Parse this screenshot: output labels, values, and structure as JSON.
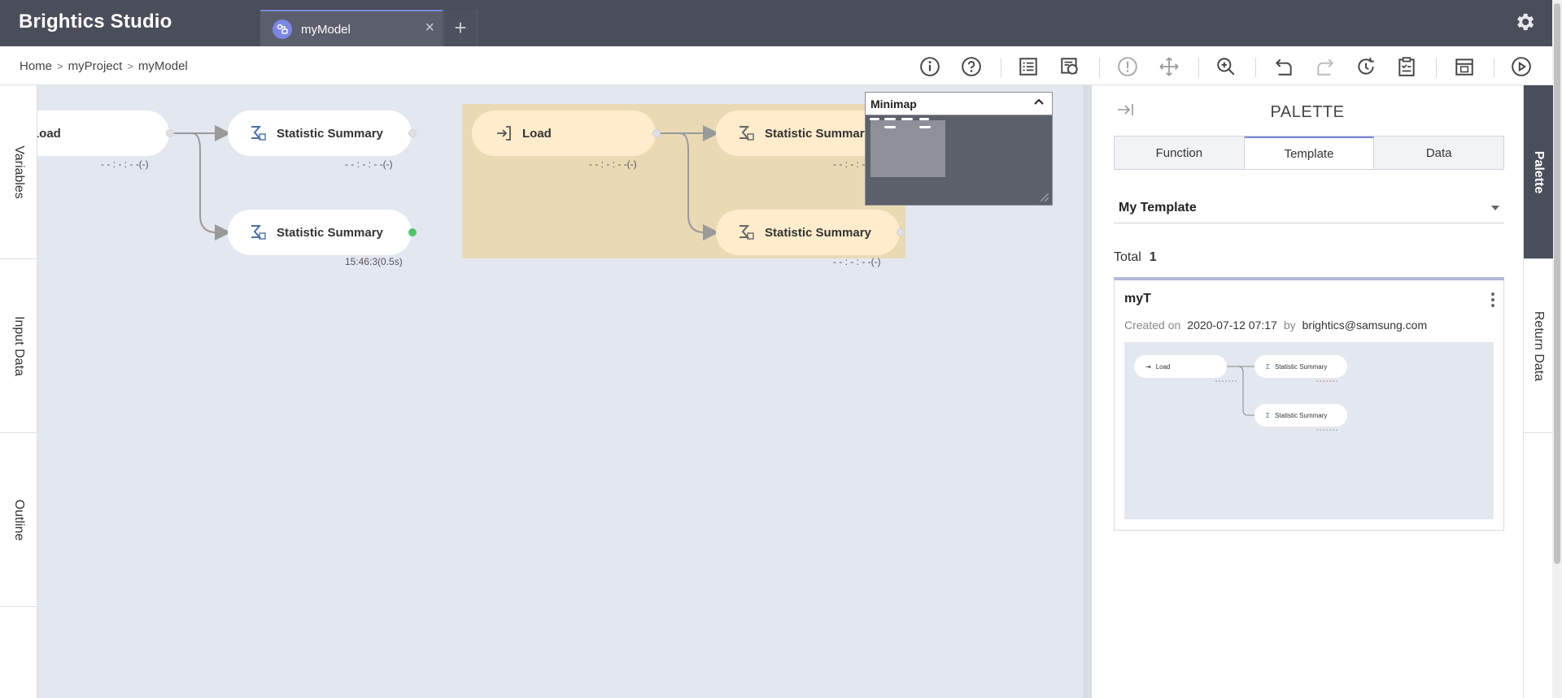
{
  "app": {
    "title": "Brightics Studio"
  },
  "tabs": [
    {
      "label": "myModel",
      "active": true
    }
  ],
  "breadcrumb": [
    "Home",
    "myProject",
    "myModel"
  ],
  "toolbar": {
    "tools": [
      "info-icon",
      "help-icon",
      "checklist-icon",
      "report-icon",
      "warning-icon",
      "move-icon",
      "zoom-icon",
      "undo-icon",
      "redo-icon",
      "refresh-icon",
      "clipboard-icon",
      "calendar-icon",
      "run-icon"
    ]
  },
  "left_rail": {
    "items": [
      "Variables",
      "Input Data",
      "Outline"
    ]
  },
  "canvas": {
    "nodes": [
      {
        "label": "Load",
        "status": "- - : - : -  -(-)"
      },
      {
        "label": "Statistic Summary",
        "status": "- - : - : -  -(-)"
      },
      {
        "label": "Statistic Summary",
        "status": "15:46:3(0.5s)"
      },
      {
        "label": "Load",
        "status": "- - : - : -  -(-)"
      },
      {
        "label": "Statistic Summary",
        "status": "- - : - : -"
      },
      {
        "label": "Statistic Summary",
        "status": "- - : - : -  -(-)"
      }
    ]
  },
  "minimap": {
    "title": "Minimap"
  },
  "palette": {
    "title": "PALETTE",
    "tabs": [
      "Function",
      "Template",
      "Data"
    ],
    "active_tab": "Template",
    "dropdown": "My Template",
    "total_label": "Total",
    "total_value": "1",
    "card": {
      "title": "myT",
      "created_label": "Created on",
      "created_value": "2020-07-12 07:17",
      "by_label": "by",
      "author": "brightics@samsung.com",
      "preview_nodes": [
        "Load",
        "Statistic Summary",
        "Statistic Summary"
      ]
    }
  },
  "right_rail": {
    "items": [
      "Palette",
      "Return Data"
    ],
    "active": "Palette"
  },
  "colors": {
    "topbar": "#4a4e5b",
    "accent": "#7b84dc",
    "selection": "#ffeccc",
    "success": "#52c26a"
  }
}
